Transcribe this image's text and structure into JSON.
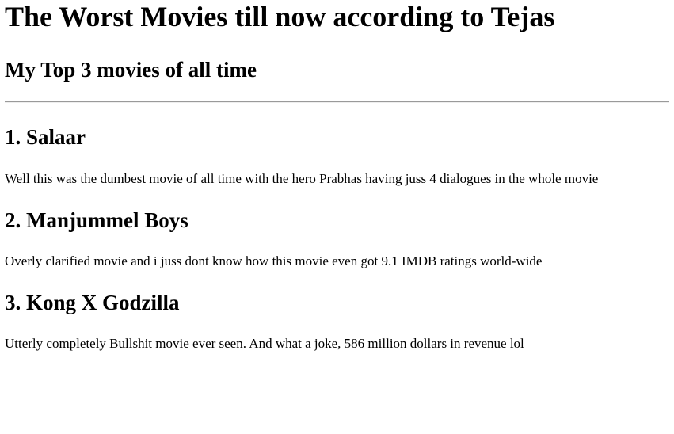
{
  "page": {
    "heading": "The Worst Movies till now according to Tejas",
    "subheading": "My Top 3 movies of all time"
  },
  "movies": [
    {
      "title": "1. Salaar",
      "description": "Well this was the dumbest movie of all time with the hero Prabhas having juss 4 dialogues in the whole movie"
    },
    {
      "title": "2. Manjummel Boys",
      "description": "Overly clarified movie and i juss dont know how this movie even got 9.1 IMDB ratings world-wide"
    },
    {
      "title": "3. Kong X Godzilla",
      "description": "Utterly completely Bullshit movie ever seen. And what a joke, 586 million dollars in revenue lol"
    }
  ]
}
